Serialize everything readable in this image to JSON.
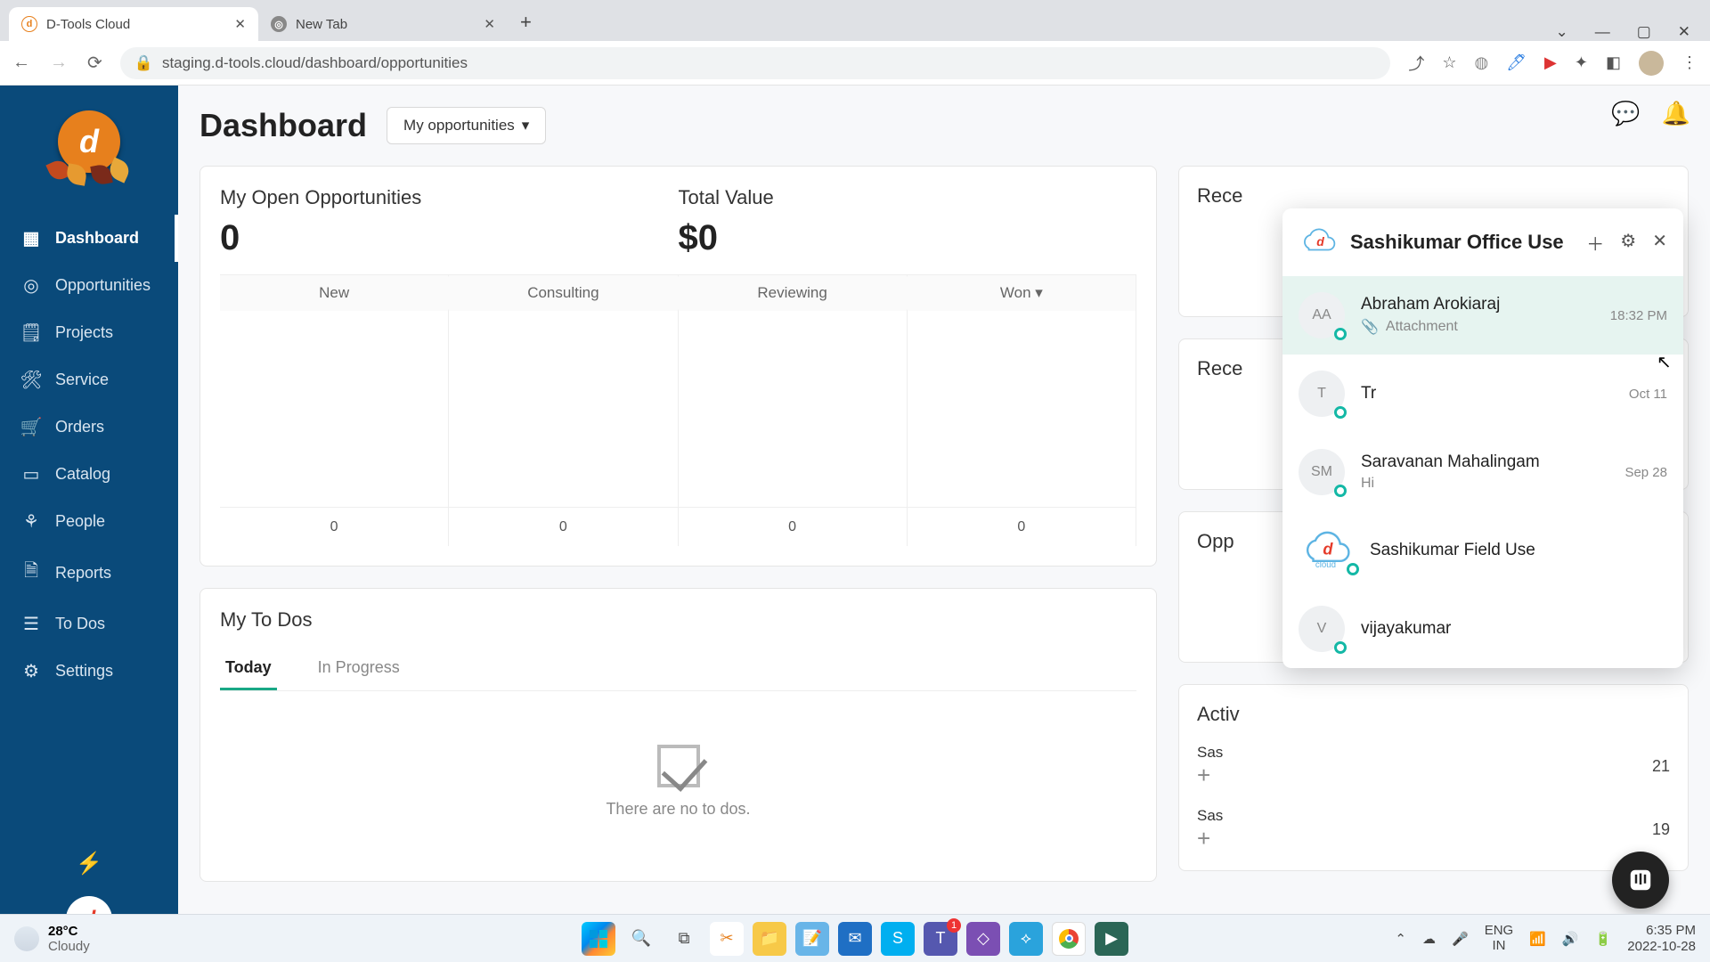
{
  "browser": {
    "tabs": [
      {
        "title": "D-Tools Cloud",
        "active": true
      },
      {
        "title": "New Tab",
        "active": false
      }
    ],
    "url": "staging.d-tools.cloud/dashboard/opportunities"
  },
  "sidebar": {
    "items": [
      {
        "label": "Dashboard",
        "icon": "grid-icon"
      },
      {
        "label": "Opportunities",
        "icon": "target-icon"
      },
      {
        "label": "Projects",
        "icon": "clipboard-icon"
      },
      {
        "label": "Service",
        "icon": "wrench-icon"
      },
      {
        "label": "Orders",
        "icon": "cart-icon"
      },
      {
        "label": "Catalog",
        "icon": "book-icon"
      },
      {
        "label": "People",
        "icon": "people-icon"
      },
      {
        "label": "Reports",
        "icon": "document-icon"
      },
      {
        "label": "To Dos",
        "icon": "list-icon"
      },
      {
        "label": "Settings",
        "icon": "gear-icon"
      }
    ]
  },
  "header": {
    "title": "Dashboard",
    "selector": "My opportunities"
  },
  "open_opportunities": {
    "title": "My Open Opportunities",
    "count": "0",
    "total_label": "Total Value",
    "total_value": "$0",
    "stages": [
      {
        "name": "New",
        "count": "0"
      },
      {
        "name": "Consulting",
        "count": "0"
      },
      {
        "name": "Reviewing",
        "count": "0"
      },
      {
        "name": "Won ▾",
        "count": "0"
      }
    ]
  },
  "todos": {
    "title": "My To Dos",
    "tabs": [
      "Today",
      "In Progress"
    ],
    "empty": "There are no to dos."
  },
  "right_cards": {
    "recent1": "Rece",
    "recent2": "Rece",
    "opp": "Opp",
    "activ": "Activ",
    "rows": [
      {
        "name": "Sas",
        "date": "21"
      },
      {
        "name": "Sas",
        "date": "19"
      }
    ]
  },
  "chat": {
    "header": "Sashikumar Office Use",
    "contacts": [
      {
        "initials": "AA",
        "name": "Abraham Arokiaraj",
        "preview": "Attachment",
        "time": "18:32 PM",
        "attachment": true,
        "online": false,
        "selected": true
      },
      {
        "initials": "T",
        "name": "Tr",
        "preview": "",
        "time": "Oct 11",
        "attachment": false,
        "online": false,
        "selected": false
      },
      {
        "initials": "SM",
        "name": "Saravanan Mahalingam",
        "preview": "Hi",
        "time": "Sep 28",
        "attachment": false,
        "online": false,
        "selected": false
      },
      {
        "initials": "",
        "name": "Sashikumar Field Use",
        "preview": "",
        "time": "",
        "attachment": false,
        "online": true,
        "selected": false,
        "cloud": true
      },
      {
        "initials": "V",
        "name": "vijayakumar",
        "preview": "",
        "time": "",
        "attachment": false,
        "online": false,
        "selected": false
      }
    ]
  },
  "taskbar": {
    "weather_temp": "28°C",
    "weather_cond": "Cloudy",
    "lang1": "ENG",
    "lang2": "IN",
    "time": "6:35 PM",
    "date": "2022-10-28"
  }
}
